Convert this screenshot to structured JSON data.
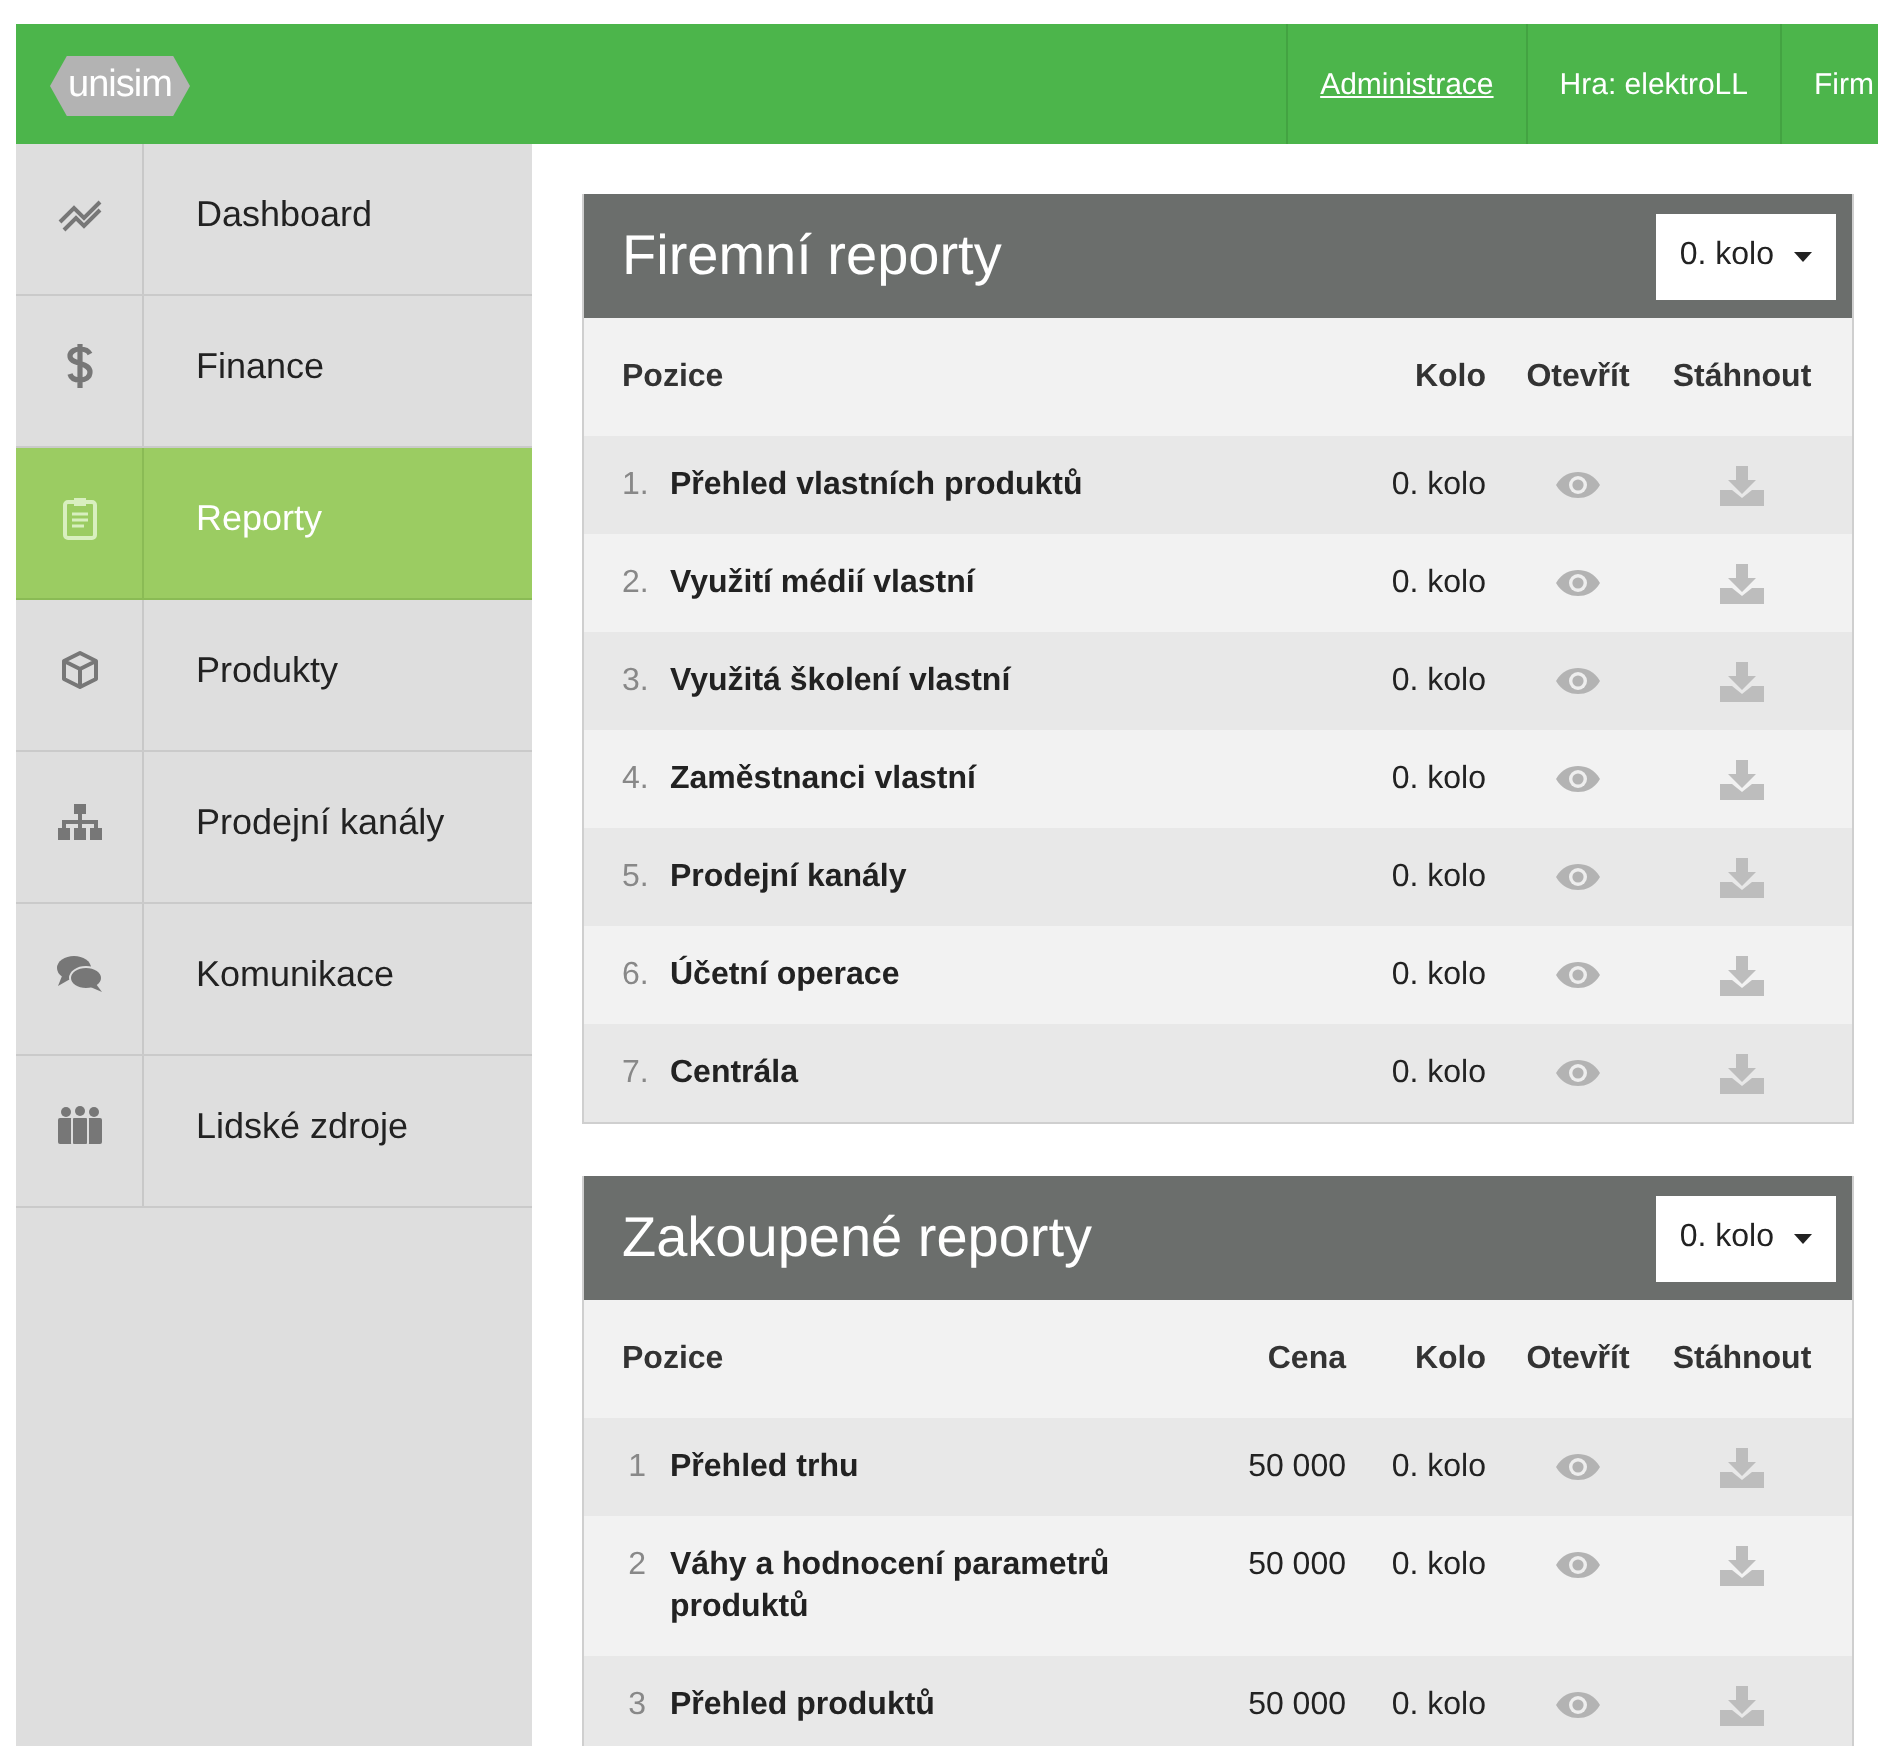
{
  "header": {
    "logo": "unisim",
    "nav": [
      {
        "label": "Administrace",
        "kind": "link"
      },
      {
        "label": "Hra: elektroLL",
        "kind": "text"
      },
      {
        "label": "Firm",
        "kind": "text"
      }
    ]
  },
  "sidebar": {
    "items": [
      {
        "label": "Dashboard",
        "selected": false
      },
      {
        "label": "Finance",
        "selected": false
      },
      {
        "label": "Reporty",
        "selected": true
      },
      {
        "label": "Produkty",
        "selected": false
      },
      {
        "label": "Prodejní kanály",
        "selected": false
      },
      {
        "label": "Komunikace",
        "selected": false
      },
      {
        "label": "Lidské zdroje",
        "selected": false
      }
    ]
  },
  "panels": [
    {
      "title": "Firemní reporty",
      "round_select": "0. kolo",
      "columns": [
        {
          "label": "Pozice",
          "kind": "name"
        },
        {
          "label": "Kolo",
          "kind": "round"
        },
        {
          "label": "Otevřít",
          "kind": "open"
        },
        {
          "label": "Stáhnout",
          "kind": "download"
        }
      ],
      "rows": [
        {
          "number": "1.",
          "name": "Přehled vlastních produktů",
          "round": "0. kolo"
        },
        {
          "number": "2.",
          "name": "Využití médií vlastní",
          "round": "0. kolo"
        },
        {
          "number": "3.",
          "name": "Využitá školení vlastní",
          "round": "0. kolo"
        },
        {
          "number": "4.",
          "name": "Zaměstnanci vlastní",
          "round": "0. kolo"
        },
        {
          "number": "5.",
          "name": "Prodejní kanály",
          "round": "0. kolo"
        },
        {
          "number": "6.",
          "name": "Účetní operace",
          "round": "0. kolo"
        },
        {
          "number": "7.",
          "name": "Centrála",
          "round": "0. kolo"
        }
      ]
    },
    {
      "title": "Zakoupené reporty",
      "round_select": "0. kolo",
      "columns": [
        {
          "label": "Pozice",
          "kind": "name"
        },
        {
          "label": "Cena",
          "kind": "price"
        },
        {
          "label": "Kolo",
          "kind": "round"
        },
        {
          "label": "Otevřít",
          "kind": "open"
        },
        {
          "label": "Stáhnout",
          "kind": "download"
        }
      ],
      "rows": [
        {
          "number": "1",
          "name": "Přehled trhu",
          "price": "50 000",
          "round": "0. kolo"
        },
        {
          "number": "2",
          "name": "Váhy a hodnocení parametrů produktů",
          "price": "50 000",
          "round": "0. kolo"
        },
        {
          "number": "3",
          "name": "Přehled produktů",
          "price": "50 000",
          "round": "0. kolo"
        }
      ]
    }
  ]
}
